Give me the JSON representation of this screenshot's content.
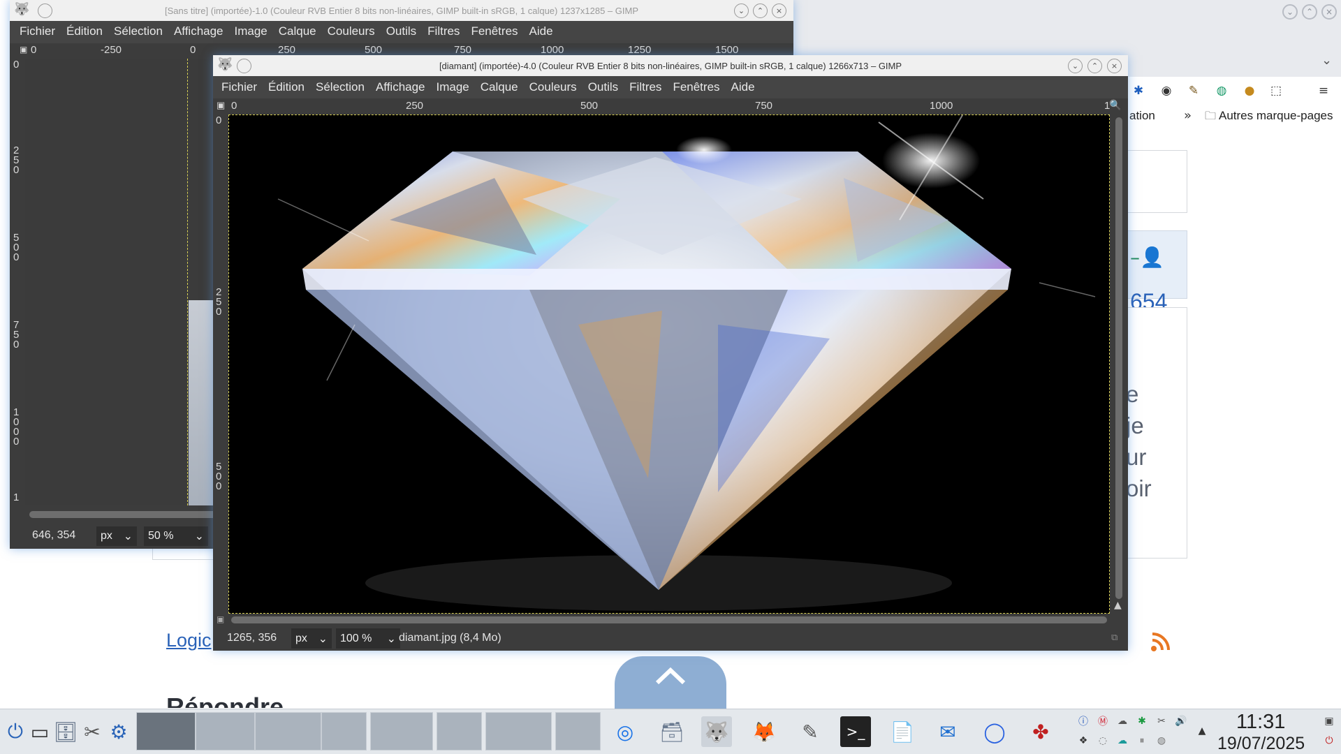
{
  "browser": {
    "bookmarks_label": "Autres marque-pages",
    "partial_tab": "ation",
    "link_number": "654",
    "partial_lines": [
      "e",
      "je",
      "ur",
      "oir"
    ],
    "logic_link": "Logic",
    "reply_heading": "Répondre"
  },
  "gimp_back": {
    "title": "[Sans titre] (importée)-1.0 (Couleur RVB Entier 8 bits non-linéaires, GIMP built-in sRGB, 1 calque) 1237x1285 – GIMP",
    "menu": [
      "Fichier",
      "Édition",
      "Sélection",
      "Affichage",
      "Image",
      "Calque",
      "Couleurs",
      "Outils",
      "Filtres",
      "Fenêtres",
      "Aide"
    ],
    "hruler": [
      "0",
      "-250",
      "0",
      "250",
      "500",
      "750",
      "1000",
      "1250",
      "1500"
    ],
    "vruler": [
      "0",
      "250",
      "500",
      "750",
      "1000",
      "1"
    ],
    "coords": "646, 354",
    "unit": "px",
    "zoom": "50 %"
  },
  "gimp_front": {
    "title": "[diamant] (importée)-4.0 (Couleur RVB Entier 8 bits non-linéaires, GIMP built-in sRGB, 1 calque) 1266x713 – GIMP",
    "menu": [
      "Fichier",
      "Édition",
      "Sélection",
      "Affichage",
      "Image",
      "Calque",
      "Couleurs",
      "Outils",
      "Filtres",
      "Fenêtres",
      "Aide"
    ],
    "hruler": [
      "0",
      "250",
      "500",
      "750",
      "1000",
      "1"
    ],
    "vruler": [
      "0",
      "250",
      "500"
    ],
    "coords": "1265, 356",
    "unit": "px",
    "zoom": "100 %",
    "file_info": "diamant.jpg (8,4 Mo)"
  },
  "taskbar": {
    "time": "11:31",
    "date": "19/07/2025"
  },
  "colors": {
    "accent": "#2f6fd0",
    "gimp_bg": "#454545",
    "canvas": "#000000",
    "taskbar": "#e4e8ec"
  }
}
